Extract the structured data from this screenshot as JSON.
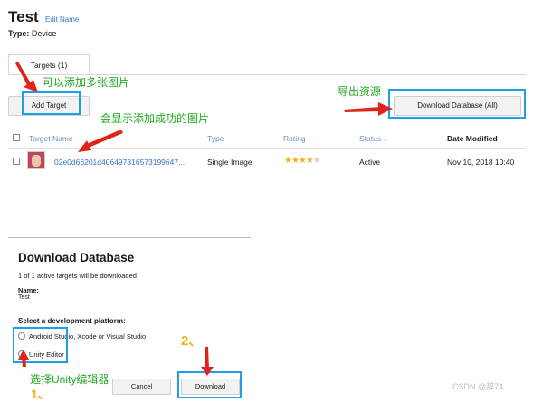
{
  "header": {
    "title": "Test",
    "edit_name": "Edit Name",
    "type_label": "Type:",
    "type_value": "Device"
  },
  "tabs": [
    {
      "label": "Targets (1)"
    }
  ],
  "toolbar": {
    "add_target": "Add Target",
    "download_database": "Download Database (All)"
  },
  "table": {
    "columns": [
      "Target Name",
      "Type",
      "Rating",
      "Status",
      "Date Modified"
    ],
    "rows": [
      {
        "name": "02e0d66201d406497316573199647...",
        "type": "Single Image",
        "rating": 4,
        "rating_max": 5,
        "status": "Active",
        "date": "Nov 10, 2018 10:40"
      }
    ]
  },
  "annotations": {
    "add_multiple": "可以添加多张图片",
    "export": "导出资源",
    "show_added": "会显示添加成功的图片",
    "choose_unity": "选择Unity编辑器",
    "step2": "2、",
    "step1": "1、",
    "arrow_color": "#e0241b",
    "highlight_color": "#1e9fe6",
    "text_color": "#22aa22"
  },
  "modal": {
    "title": "Download Database",
    "subtitle": "1 of 1 active targets will be downloaded",
    "name_label": "Name:",
    "name_value": "Test",
    "platform_label": "Select a development platform:",
    "options": [
      {
        "label": "Android Studio, Xcode or Visual Studio",
        "selected": false
      },
      {
        "label": "Unity Editor",
        "selected": true
      }
    ],
    "cancel": "Cancel",
    "download": "Download"
  },
  "watermark": "CSDN @辞74"
}
